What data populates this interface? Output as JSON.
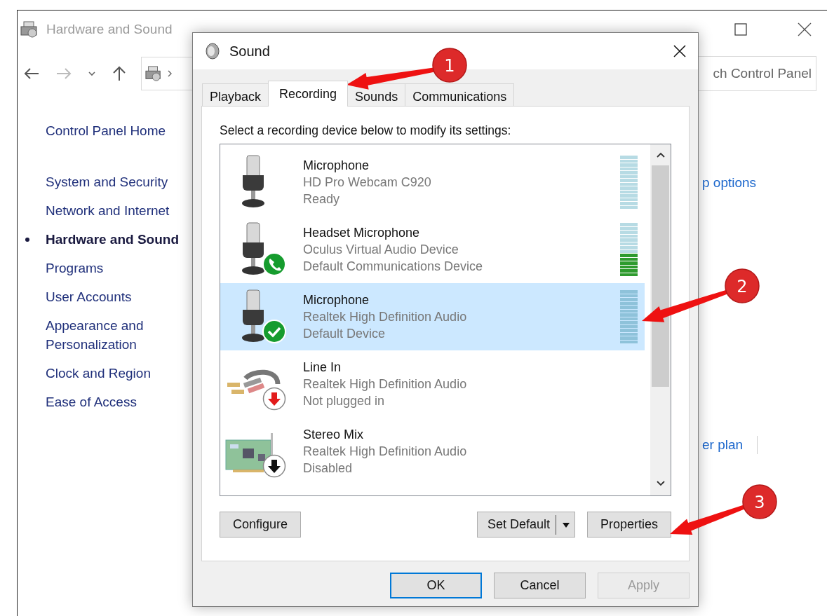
{
  "background_window": {
    "title": "Hardware and Sound",
    "search": {
      "placeholder": "ch Control Panel"
    },
    "sidebar": {
      "items": [
        {
          "label": "Control Panel Home",
          "selected": false
        },
        {
          "label": "System and Security",
          "selected": false
        },
        {
          "label": "Network and Internet",
          "selected": false
        },
        {
          "label": "Hardware and Sound",
          "selected": true
        },
        {
          "label": "Programs",
          "selected": false
        },
        {
          "label": "User Accounts",
          "selected": false
        },
        {
          "label": "Appearance and Personalization",
          "selected": false
        },
        {
          "label": "Clock and Region",
          "selected": false
        },
        {
          "label": "Ease of Access",
          "selected": false
        }
      ]
    },
    "links": [
      "p options",
      "er plan"
    ]
  },
  "dialog": {
    "title": "Sound",
    "tabs": [
      {
        "label": "Playback",
        "selected": false
      },
      {
        "label": "Recording",
        "selected": true
      },
      {
        "label": "Sounds",
        "selected": false
      },
      {
        "label": "Communications",
        "selected": false
      }
    ],
    "instruction": "Select a recording device below to modify its settings:",
    "devices": [
      {
        "name": "Microphone",
        "description": "HD Pro Webcam C920",
        "status": "Ready",
        "kind": "microphone",
        "selected": false
      },
      {
        "name": "Headset Microphone",
        "description": "Oculus Virtual Audio Device",
        "status": "Default Communications Device",
        "kind": "communications",
        "level": 0.43,
        "selected": false
      },
      {
        "name": "Microphone",
        "description": "Realtek High Definition Audio",
        "status": "Default Device",
        "kind": "default",
        "selected": true
      },
      {
        "name": "Line In",
        "description": "Realtek High Definition Audio",
        "status": "Not plugged in",
        "kind": "unplugged",
        "selected": false
      },
      {
        "name": "Stereo Mix",
        "description": "Realtek High Definition Audio",
        "status": "Disabled",
        "kind": "disabled",
        "selected": false
      }
    ],
    "actions": [
      {
        "label": "Configure",
        "kind": "plain"
      },
      {
        "label": "Set Default",
        "kind": "split"
      },
      {
        "label": "Properties",
        "kind": "plain"
      }
    ],
    "buttons": [
      {
        "label": "OK",
        "default": true,
        "disabled": false
      },
      {
        "label": "Cancel",
        "default": false,
        "disabled": false
      },
      {
        "label": "Apply",
        "default": false,
        "disabled": true
      }
    ]
  },
  "annotations": [
    {
      "label": "1"
    },
    {
      "label": "2"
    },
    {
      "label": "3"
    }
  ]
}
